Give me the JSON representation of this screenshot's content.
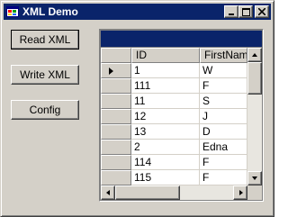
{
  "window": {
    "title": "XML Demo"
  },
  "buttons": {
    "read_xml": "Read XML",
    "write_xml": "Write XML",
    "config": "Config"
  },
  "grid": {
    "columns": [
      "ID",
      "FirstName"
    ],
    "rows": [
      {
        "id": "1",
        "first_name": "W",
        "current": true
      },
      {
        "id": "111",
        "first_name": "F",
        "current": false
      },
      {
        "id": "11",
        "first_name": "S",
        "current": false
      },
      {
        "id": "12",
        "first_name": "J",
        "current": false
      },
      {
        "id": "13",
        "first_name": "D",
        "current": false
      },
      {
        "id": "2",
        "first_name": "Edna",
        "current": false
      },
      {
        "id": "114",
        "first_name": "F",
        "current": false
      },
      {
        "id": "115",
        "first_name": "F",
        "current": false
      }
    ]
  },
  "colors": {
    "titlebar": "#0a246a",
    "face": "#d4d0c8",
    "grid_background": "#808080"
  }
}
